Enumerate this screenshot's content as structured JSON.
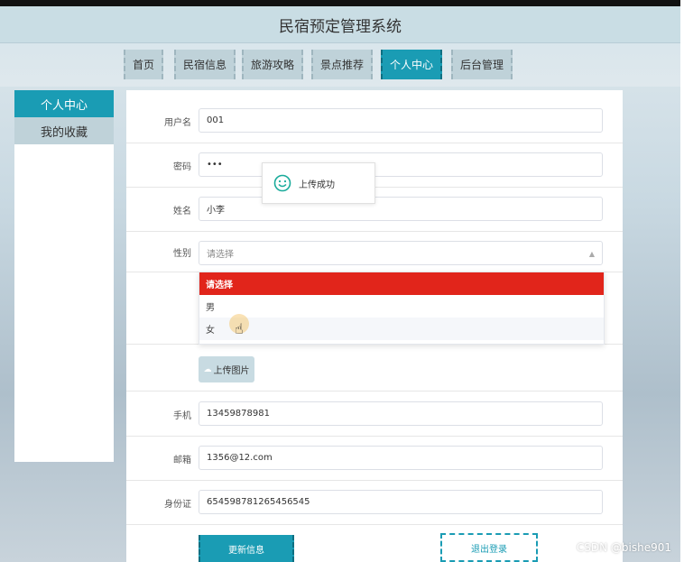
{
  "app": {
    "title": "民宿预定管理系统"
  },
  "nav": {
    "items": [
      {
        "label": "首页"
      },
      {
        "label": "民宿信息"
      },
      {
        "label": "旅游攻略"
      },
      {
        "label": "景点推荐"
      },
      {
        "label": "个人中心",
        "active": true
      },
      {
        "label": "后台管理"
      }
    ]
  },
  "sidebar": {
    "items": [
      {
        "label": "个人中心",
        "active": true
      },
      {
        "label": "我的收藏"
      }
    ]
  },
  "form": {
    "username": {
      "label": "用户名",
      "value": "001"
    },
    "password": {
      "label": "密码",
      "value": "•••"
    },
    "name": {
      "label": "姓名",
      "value": "小李"
    },
    "gender": {
      "label": "性别",
      "placeholder": "请选择"
    },
    "phone": {
      "label": "手机",
      "value": "13459878981"
    },
    "email": {
      "label": "邮箱",
      "value": "1356@12.com"
    },
    "idcard": {
      "label": "身份证",
      "value": "654598781265456545"
    }
  },
  "gender_dropdown": {
    "options": [
      {
        "label": "请选择",
        "selected": true
      },
      {
        "label": "男"
      },
      {
        "label": "女",
        "hover": true
      }
    ]
  },
  "upload": {
    "label": "上传图片"
  },
  "toast": {
    "message": "上传成功"
  },
  "actions": {
    "update_label": "更新信息",
    "logout_label": "退出登录"
  },
  "watermark": "CSDN @bishe901",
  "colors": {
    "accent": "#1a9cb4",
    "selected_option": "#e1251b",
    "tab_bg": "#bfd2d9"
  }
}
